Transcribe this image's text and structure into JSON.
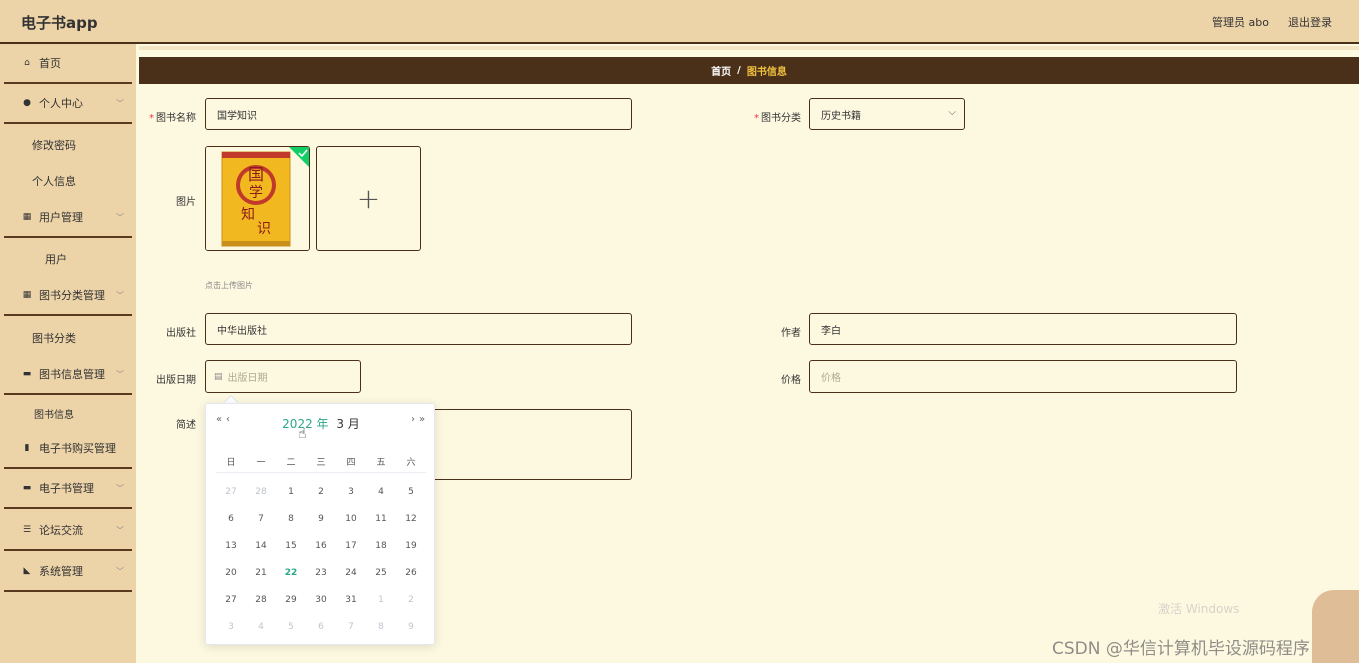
{
  "app": {
    "title": "电子书app",
    "admin": "管理员 abo",
    "logout": "退出登录"
  },
  "sidebar": {
    "home": "首页",
    "personal_center": "个人中心",
    "change_password": "修改密码",
    "personal_info": "个人信息",
    "user_mgmt": "用户管理",
    "users": "用户",
    "category_mgmt": "图书分类管理",
    "category": "图书分类",
    "book_info_mgmt": "图书信息管理",
    "book_info": "图书信息",
    "purchase_mgmt": "电子书购买管理",
    "ebook_mgmt": "电子书管理",
    "forum": "论坛交流",
    "system_mgmt": "系统管理"
  },
  "breadcrumb": {
    "home": "首页",
    "sep": "/",
    "current": "图书信息"
  },
  "form": {
    "book_name_label": "图书名称",
    "book_name_value": "国学知识",
    "category_label": "图书分类",
    "category_value": "历史书籍",
    "image_label": "图片",
    "upload_hint": "点击上传图片",
    "publisher_label": "出版社",
    "publisher_value": "中华出版社",
    "author_label": "作者",
    "author_value": "李白",
    "pub_date_label": "出版日期",
    "pub_date_placeholder": "出版日期",
    "price_label": "价格",
    "price_placeholder": "价格",
    "desc_label": "简述"
  },
  "datepicker": {
    "year": "2022 年",
    "month": "3 月",
    "weekdays": [
      "日",
      "一",
      "二",
      "三",
      "四",
      "五",
      "六"
    ],
    "weeks": [
      [
        "27",
        "28",
        "1",
        "2",
        "3",
        "4",
        "5"
      ],
      [
        "6",
        "7",
        "8",
        "9",
        "10",
        "11",
        "12"
      ],
      [
        "13",
        "14",
        "15",
        "16",
        "17",
        "18",
        "19"
      ],
      [
        "20",
        "21",
        "22",
        "23",
        "24",
        "25",
        "26"
      ],
      [
        "27",
        "28",
        "29",
        "30",
        "31",
        "1",
        "2"
      ],
      [
        "3",
        "4",
        "5",
        "6",
        "7",
        "8",
        "9"
      ]
    ],
    "today": "22"
  },
  "watermark": {
    "text": "CSDN @华信计算机毕设源码程序",
    "activate": "激活 Windows"
  },
  "colors": {
    "header_bg": "#ecd3a8",
    "dark": "#4a3019",
    "accent": "#2aa889",
    "page_bg": "#fdf9e1"
  }
}
